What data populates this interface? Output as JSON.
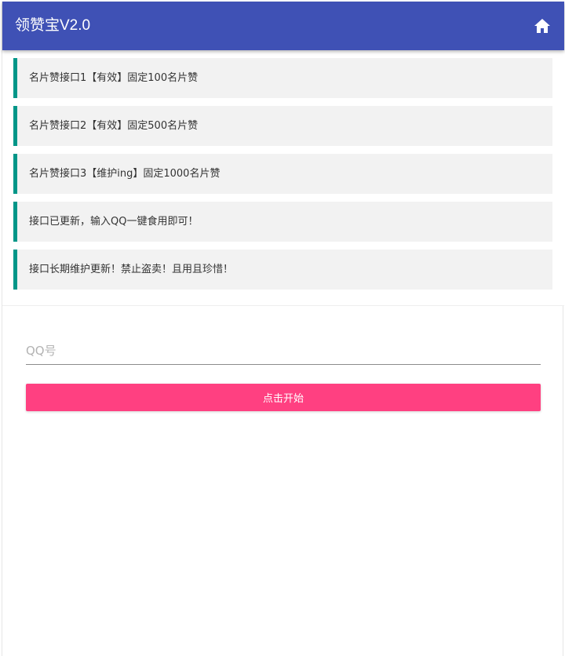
{
  "header": {
    "title": "领赞宝V2.0",
    "home_icon": "home-icon",
    "background": "#3f51b5"
  },
  "notices": [
    {
      "text": "名片赞接口1【有效】固定100名片赞"
    },
    {
      "text": "名片赞接口2【有效】固定500名片赞"
    },
    {
      "text": "名片赞接口3【维护ing】固定1000名片赞"
    },
    {
      "text": "接口已更新，输入QQ一键食用即可！"
    },
    {
      "text": "接口长期维护更新！禁止盗卖！且用且珍惜！"
    }
  ],
  "notice_accent": "#009688",
  "form": {
    "qq_placeholder": "QQ号",
    "qq_value": "",
    "submit_label": "点击开始",
    "submit_color": "#ff4081"
  }
}
